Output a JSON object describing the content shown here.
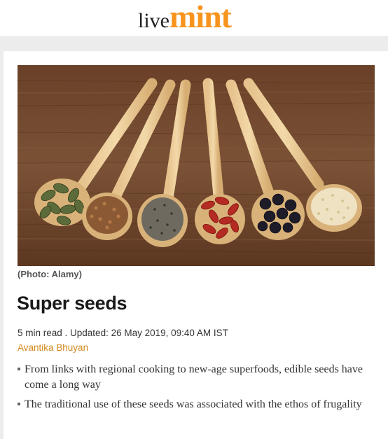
{
  "brand": {
    "logo_part1": "live",
    "logo_part2": "mint",
    "accent_color": "#f7941d"
  },
  "article": {
    "image_caption": "(Photo: Alamy)",
    "title": "Super seeds",
    "meta": "5 min read . Updated: 26 May 2019, 09:40 AM IST",
    "author": "Avantika Bhuyan",
    "summary": [
      "From links with regional cooking to new-age superfoods, edible seeds have come a long way",
      "The traditional use of these seeds was associated with the ethos of frugality"
    ]
  }
}
